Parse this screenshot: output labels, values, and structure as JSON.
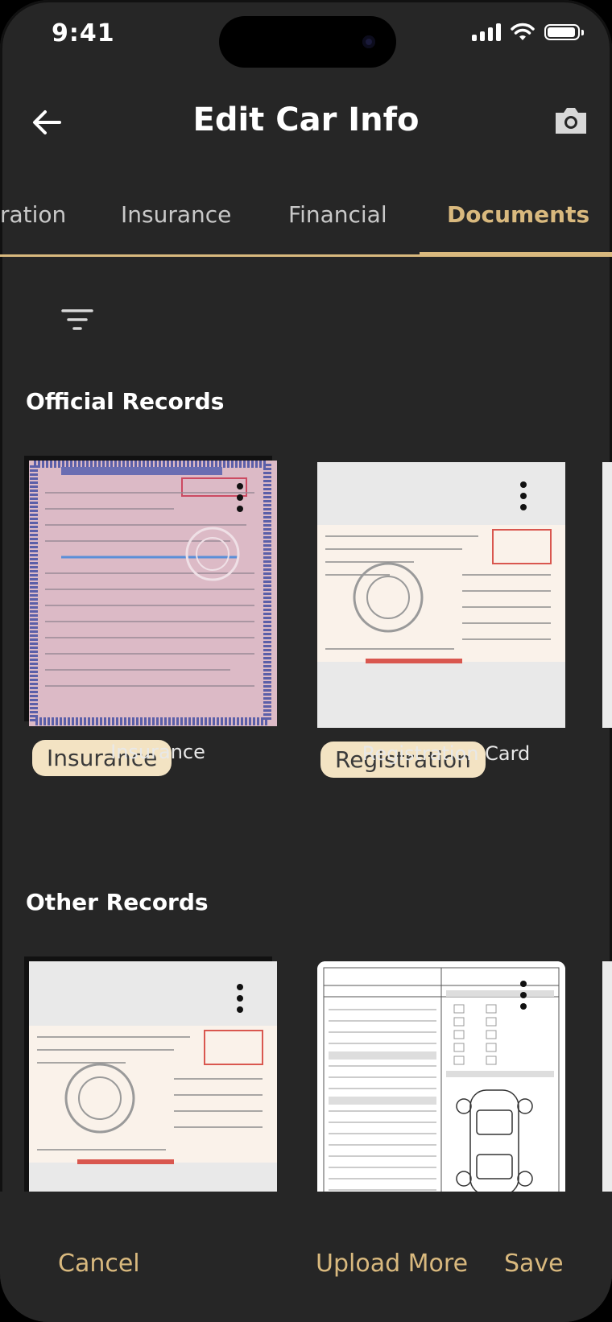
{
  "status_bar": {
    "time": "9:41"
  },
  "header": {
    "title": "Edit Car Info"
  },
  "tabs": [
    {
      "label": "ration"
    },
    {
      "label": "Insurance"
    },
    {
      "label": "Financial"
    },
    {
      "label": "Documents",
      "active": true
    }
  ],
  "sections": [
    {
      "title": "Official Records",
      "documents": [
        {
          "tag": "Insurance",
          "caption": "Insurance"
        },
        {
          "tag": "Registration",
          "caption": "Registration Card"
        }
      ]
    },
    {
      "title": "Other Records",
      "documents": [
        {
          "tag": "",
          "caption": ""
        },
        {
          "tag": "",
          "caption": ""
        }
      ]
    }
  ],
  "footer": {
    "cancel_label": "Cancel",
    "upload_label": "Upload More",
    "save_label": "Save"
  },
  "colors": {
    "background": "#262626",
    "accent": "#d9b97e",
    "tag_background": "#f3e3c3"
  }
}
